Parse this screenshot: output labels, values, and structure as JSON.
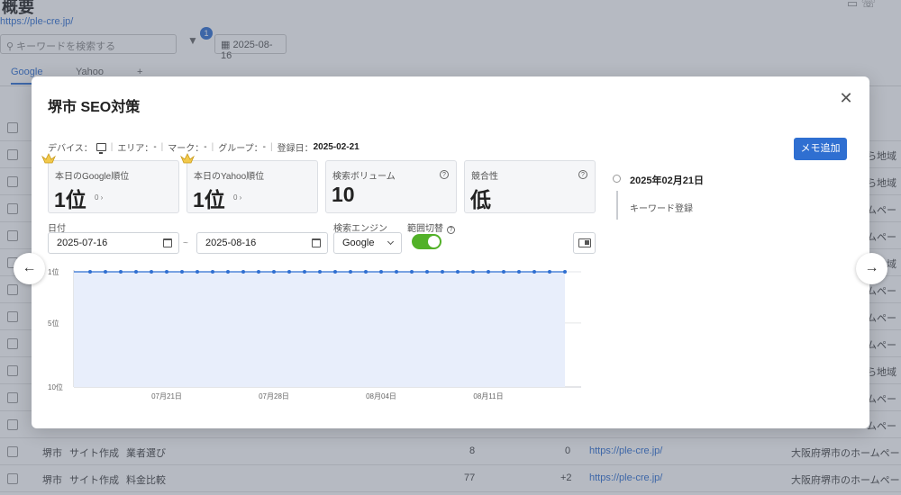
{
  "background": {
    "title": "概要",
    "url": "https://ple-cre.jp/",
    "search_placeholder": "キーワードを検索する",
    "filter_badge": "1",
    "date": "2025-08-16",
    "tabs": [
      "Google",
      "Yahoo",
      "+"
    ],
    "rows": [
      {
        "area": "堺市",
        "k1": "サイト作成",
        "k2": "業者選び",
        "rank": "8",
        "diff": "0",
        "url": "https://ple-cre.jp/",
        "title": "大阪府堺市のホームペー"
      },
      {
        "area": "堺市",
        "k1": "サイト作成",
        "k2": "料金比較",
        "rank": "77",
        "diff": "+2",
        "url": "https://ple-cre.jp/",
        "title": "大阪府堺市のホームペー"
      }
    ],
    "right_col": [
      "ら地域",
      "ら地域",
      "ムペー",
      "ムペー",
      "ら地域",
      "ムペー",
      "ムペー",
      "ムペー",
      "ら地域",
      "ムペー",
      "ムペー"
    ]
  },
  "modal": {
    "title": "堺市 SEO対策",
    "meta": {
      "device_label": "デバイス：",
      "area_label": "エリア：",
      "area_value": "-",
      "mark_label": "マーク：",
      "mark_value": "-",
      "group_label": "グループ：",
      "group_value": "-",
      "registered_label": "登録日：",
      "registered_value": "2025-02-21"
    },
    "memo_button": "メモ追加",
    "cards": [
      {
        "label": "本日のGoogle順位",
        "value": "1位",
        "sub": "0 ›"
      },
      {
        "label": "本日のYahoo順位",
        "value": "1位",
        "sub": "0 ›"
      },
      {
        "label": "検索ボリューム",
        "value": "10"
      },
      {
        "label": "競合性",
        "value": "低"
      }
    ],
    "filters": {
      "date_label": "日付",
      "date_from": "2025-07-16",
      "date_to": "2025-08-16",
      "tilde": "~",
      "engine_label": "検索エンジン",
      "engine_value": "Google",
      "range_label": "範囲切替",
      "range_toggle_on": true
    },
    "timeline": {
      "date": "2025年02月21日",
      "event": "キーワード登録"
    }
  },
  "colors": {
    "primary": "#2f6fd1",
    "toggle_on": "#52b128",
    "chart_line": "#2f6fd1",
    "chart_fill": "#e8eefb"
  },
  "chart_data": {
    "type": "area",
    "title": "",
    "xlabel": "",
    "ylabel": "",
    "y_inverted": true,
    "ylim": [
      1,
      10
    ],
    "y_ticks": [
      "1位",
      "5位",
      "10位"
    ],
    "x_tick_labels": [
      "07月21日",
      "07月28日",
      "08月04日",
      "08月11日"
    ],
    "x": [
      "2025-07-16",
      "2025-07-17",
      "2025-07-18",
      "2025-07-19",
      "2025-07-20",
      "2025-07-21",
      "2025-07-22",
      "2025-07-23",
      "2025-07-24",
      "2025-07-25",
      "2025-07-26",
      "2025-07-27",
      "2025-07-28",
      "2025-07-29",
      "2025-07-30",
      "2025-07-31",
      "2025-08-01",
      "2025-08-02",
      "2025-08-03",
      "2025-08-04",
      "2025-08-05",
      "2025-08-06",
      "2025-08-07",
      "2025-08-08",
      "2025-08-09",
      "2025-08-10",
      "2025-08-11",
      "2025-08-12",
      "2025-08-13",
      "2025-08-14",
      "2025-08-15",
      "2025-08-16"
    ],
    "series": [
      {
        "values": [
          1,
          1,
          1,
          1,
          1,
          1,
          1,
          1,
          1,
          1,
          1,
          1,
          1,
          1,
          1,
          1,
          1,
          1,
          1,
          1,
          1,
          1,
          1,
          1,
          1,
          1,
          1,
          1,
          1,
          1,
          1,
          1
        ]
      }
    ]
  }
}
